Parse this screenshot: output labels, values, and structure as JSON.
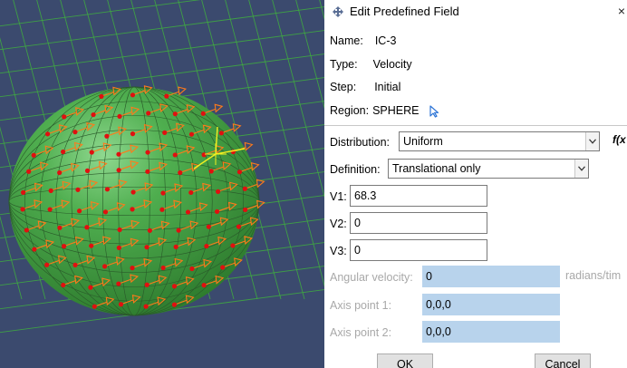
{
  "dialog": {
    "title": "Edit Predefined Field",
    "close_glyph": "×",
    "name_label": "Name:",
    "name_value": "IC-3",
    "type_label": "Type:",
    "type_value": "Velocity",
    "step_label": "Step:",
    "step_value": "Initial",
    "region_label": "Region:",
    "region_value": "SPHERE",
    "distribution_label": "Distribution:",
    "distribution_value": "Uniform",
    "fx_label": "f(x",
    "definition_label": "Definition:",
    "definition_value": "Translational only",
    "v1_label": "V1:",
    "v1_value": "68.3",
    "v2_label": "V2:",
    "v2_value": "0",
    "v3_label": "V3:",
    "v3_value": "0",
    "angular_label": "Angular velocity:",
    "angular_value": "0",
    "angular_units": "radians/tim",
    "axis1_label": "Axis point 1:",
    "axis1_value": "0,0,0",
    "axis2_label": "Axis point 2:",
    "axis2_value": "0,0,0",
    "ok_label": "OK",
    "cancel_label": "Cancel"
  },
  "viewport": {
    "background_color": "#3b4a6e",
    "grid_color": "#3fae3f",
    "sphere_color": "#3f9a3f",
    "arrow_color": "#ff7a1a",
    "node_color": "#e01010",
    "icons": [
      "velocity-arrow-icon",
      "node-marker-icon",
      "axis-triad-icon"
    ]
  },
  "colors": {
    "disabled_field": "#b8d3ec",
    "disabled_text": "#a8a8a8",
    "region_arrow": "#2b73d6"
  }
}
